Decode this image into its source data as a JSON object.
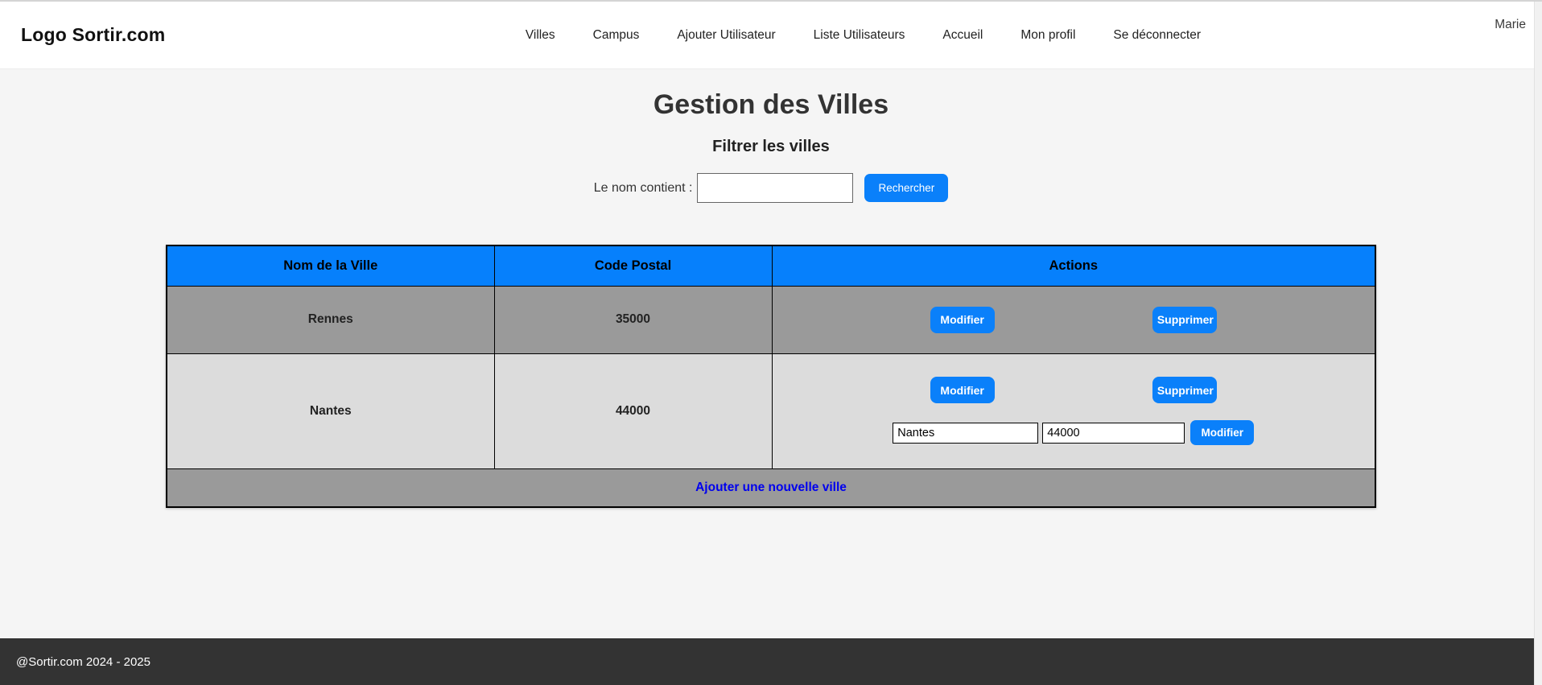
{
  "nav": {
    "logo": "Logo Sortir.com",
    "items": [
      "Villes",
      "Campus",
      "Ajouter Utilisateur",
      "Liste Utilisateurs",
      "Accueil",
      "Mon profil",
      "Se déconnecter"
    ],
    "user": "Marie"
  },
  "page": {
    "title": "Gestion des Villes",
    "filter_heading": "Filtrer les villes",
    "filter_label": "Le nom contient :",
    "filter_value": "",
    "search_button": "Rechercher"
  },
  "table": {
    "headers": [
      "Nom de la Ville",
      "Code Postal",
      "Actions"
    ],
    "rows": [
      {
        "name": "Rennes",
        "code": "35000",
        "actions": [
          "Modifier",
          "Supprimer"
        ]
      },
      {
        "name": "Nantes",
        "code": "44000",
        "actions": [
          "Modifier",
          "Supprimer"
        ],
        "edit_form": {
          "name_value": "Nantes",
          "code_value": "44000",
          "submit": "Modifier"
        }
      }
    ],
    "footer_link": "Ajouter une nouvelle ville"
  },
  "footer": {
    "copyright": "@Sortir.com 2024 - 2025"
  },
  "colors": {
    "header_blue": "#0680fc",
    "button_blue": "#0a80fa",
    "link_blue": "#0000ee",
    "row_dark_gray": "#9a9a9a",
    "row_light_gray": "#dcdcdc",
    "footer_dark": "#333333",
    "page_background": "#f5f5f5"
  }
}
